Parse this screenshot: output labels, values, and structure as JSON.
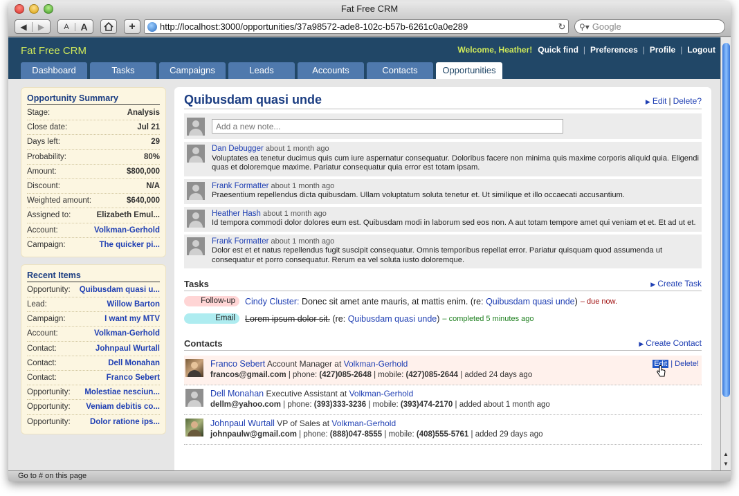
{
  "window": {
    "title": "Fat Free CRM"
  },
  "browser": {
    "font_small": "A",
    "font_large": "A",
    "add_icon": "+",
    "url": "http://localhost:3000/opportunities/37a98572-ade8-102c-b57b-6261c0a0e289",
    "search_placeholder": "Google",
    "status_text": "Go to # on this page"
  },
  "header": {
    "brand": "Fat Free CRM",
    "welcome": "Welcome, Heather!",
    "links": [
      "Quick find",
      "Preferences",
      "Profile",
      "Logout"
    ]
  },
  "tabs": [
    "Dashboard",
    "Tasks",
    "Campaigns",
    "Leads",
    "Accounts",
    "Contacts",
    "Opportunities"
  ],
  "active_tab": "Opportunities",
  "summary": {
    "title": "Opportunity Summary",
    "rows": [
      {
        "label": "Stage:",
        "value": "Analysis"
      },
      {
        "label": "Close date:",
        "value": "Jul 21"
      },
      {
        "label": "Days left:",
        "value": "29"
      },
      {
        "label": "Probability:",
        "value": "80%"
      },
      {
        "label": "Amount:",
        "value": "$800,000"
      },
      {
        "label": "Discount:",
        "value": "N/A"
      },
      {
        "label": "Weighted amount:",
        "value": "$640,000"
      },
      {
        "label": "Assigned to:",
        "value": "Elizabeth Emul..."
      },
      {
        "label": "Account:",
        "value": "Volkman-Gerhold"
      },
      {
        "label": "Campaign:",
        "value": "The quicker pi..."
      }
    ]
  },
  "recent": {
    "title": "Recent Items",
    "rows": [
      {
        "label": "Opportunity:",
        "value": "Quibusdam quasi u..."
      },
      {
        "label": "Lead:",
        "value": "Willow Barton"
      },
      {
        "label": "Campaign:",
        "value": "I want my MTV"
      },
      {
        "label": "Account:",
        "value": "Volkman-Gerhold"
      },
      {
        "label": "Contact:",
        "value": "Johnpaul Wurtall"
      },
      {
        "label": "Contact:",
        "value": "Dell Monahan"
      },
      {
        "label": "Contact:",
        "value": "Franco Sebert"
      },
      {
        "label": "Opportunity:",
        "value": "Molestiae nesciun..."
      },
      {
        "label": "Opportunity:",
        "value": "Veniam debitis co..."
      },
      {
        "label": "Opportunity:",
        "value": "Dolor ratione ips..."
      }
    ]
  },
  "opportunity": {
    "title": "Quibusdam quasi unde",
    "edit_label": "Edit",
    "delete_label": "Delete?",
    "note_placeholder": "Add a new note..."
  },
  "comments": [
    {
      "author": "Dan Debugger",
      "when": "about 1 month ago",
      "text": "Voluptates ea tenetur ducimus quis cum iure aspernatur consequatur. Doloribus facere non minima quis maxime corporis aliquid quia. Eligendi quas et doloremque maxime. Pariatur consequatur quia error est totam ipsam."
    },
    {
      "author": "Frank Formatter",
      "when": "about 1 month ago",
      "text": "Praesentium repellendus dicta quibusdam. Ullam voluptatum soluta tenetur et. Ut similique et illo occaecati accusantium."
    },
    {
      "author": "Heather Hash",
      "when": "about 1 month ago",
      "text": "Id tempora commodi dolor dolores eum est. Quibusdam modi in laborum sed eos non. A aut totam tempore amet qui veniam et et. Et ad ut et."
    },
    {
      "author": "Frank Formatter",
      "when": "about 1 month ago",
      "text": "Dolor est et et natus repellendus fugit suscipit consequatur. Omnis temporibus repellat error. Pariatur quisquam quod assumenda ut consequatur et porro consequatur. Rerum ea vel soluta iusto doloremque."
    }
  ],
  "tasks_section": {
    "title": "Tasks",
    "create_label": "Create Task",
    "items": [
      {
        "category": "Follow-up",
        "who": "Cindy Cluster:",
        "text": "Donec sit amet ante mauris, at mattis enim.",
        "re_prefix": "(re:",
        "re_link": "Quibusdam quasi unde",
        "re_suffix": ")",
        "status": "– due now."
      },
      {
        "category": "Email",
        "who": "",
        "text": "Lorem ipsum dolor sit.",
        "re_prefix": "(re:",
        "re_link": "Quibusdam quasi unde",
        "re_suffix": ")",
        "status": "– completed 5 minutes ago"
      }
    ]
  },
  "contacts_section": {
    "title": "Contacts",
    "create_label": "Create Contact",
    "edit_label": "Edit",
    "delete_label": "Delete!",
    "items": [
      {
        "name": "Franco Sebert",
        "title": "Account Manager at",
        "company": "Volkman-Gerhold",
        "email": "francos@gmail.com",
        "phone_label": "phone:",
        "phone": "(427)085-2648",
        "mobile_label": "mobile:",
        "mobile": "(427)085-2644",
        "added": "added 24 days ago"
      },
      {
        "name": "Dell Monahan",
        "title": "Executive Assistant at",
        "company": "Volkman-Gerhold",
        "email": "dellm@yahoo.com",
        "phone_label": "phone:",
        "phone": "(393)333-3236",
        "mobile_label": "mobile:",
        "mobile": "(393)474-2170",
        "added": "added about 1 month ago"
      },
      {
        "name": "Johnpaul Wurtall",
        "title": "VP of Sales at",
        "company": "Volkman-Gerhold",
        "email": "johnpaulw@gmail.com",
        "phone_label": "phone:",
        "phone": "(888)047-8555",
        "mobile_label": "mobile:",
        "mobile": "(408)555-5761",
        "added": "added 29 days ago"
      }
    ]
  }
}
